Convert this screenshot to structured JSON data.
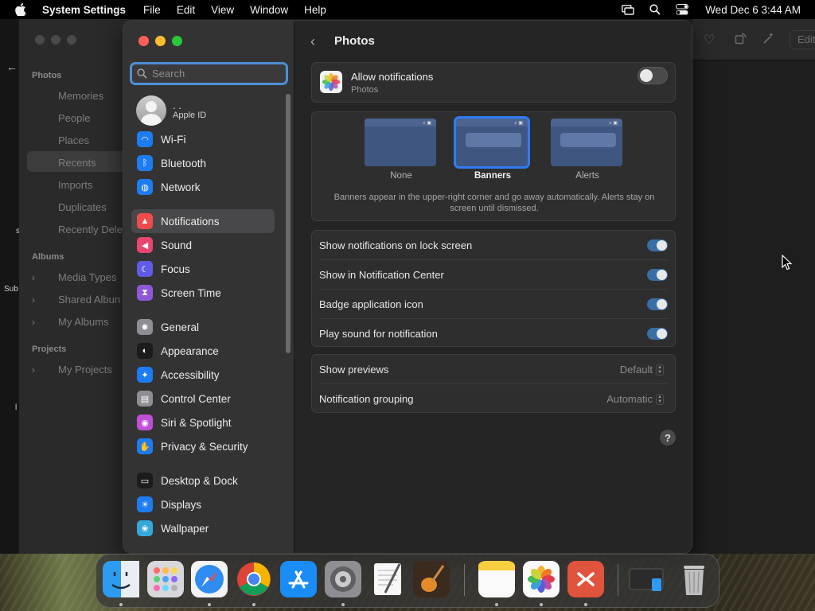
{
  "menubar": {
    "app_name": "System Settings",
    "menus": [
      "File",
      "Edit",
      "View",
      "Window",
      "Help"
    ],
    "clock": "Wed Dec 6  3:44 AM"
  },
  "photos_app": {
    "sections": {
      "photos": "Photos",
      "albums": "Albums",
      "projects": "Projects"
    },
    "items": {
      "memories": "Memories",
      "people": "People",
      "places": "Places",
      "recents": "Recents",
      "imports": "Imports",
      "duplicates": "Duplicates",
      "recently_deleted": "Recently Dele",
      "media_types": "Media Types",
      "shared_albums": "Shared Albun",
      "my_albums": "My Albums",
      "my_projects": "My Projects"
    },
    "edit_label": "Edit",
    "left_fragments": [
      "s",
      "Sub",
      "l"
    ]
  },
  "settings": {
    "search_placeholder": "Search",
    "apple_id": {
      "name": ". .",
      "label": "Apple ID"
    },
    "sidebar": [
      {
        "label": "Wi-Fi",
        "icon": "wifi-icon",
        "color": "#1e7cf2"
      },
      {
        "label": "Bluetooth",
        "icon": "bluetooth-icon",
        "color": "#1e7cf2"
      },
      {
        "label": "Network",
        "icon": "network-icon",
        "color": "#1e7cf2"
      },
      {
        "label": "Notifications",
        "icon": "bell-icon",
        "color": "#ef4b4b",
        "selected": true
      },
      {
        "label": "Sound",
        "icon": "speaker-icon",
        "color": "#e9456e"
      },
      {
        "label": "Focus",
        "icon": "moon-icon",
        "color": "#5e5ce6"
      },
      {
        "label": "Screen Time",
        "icon": "hourglass-icon",
        "color": "#8e59d8"
      },
      {
        "label": "General",
        "icon": "gear-icon",
        "color": "#8e8e93"
      },
      {
        "label": "Appearance",
        "icon": "appearance-icon",
        "color": "#1c1c1e"
      },
      {
        "label": "Accessibility",
        "icon": "accessibility-icon",
        "color": "#1e7cf2"
      },
      {
        "label": "Control Center",
        "icon": "control-center-icon",
        "color": "#8e8e93"
      },
      {
        "label": "Siri & Spotlight",
        "icon": "siri-icon",
        "color": "#c04fd6"
      },
      {
        "label": "Privacy & Security",
        "icon": "hand-icon",
        "color": "#1e7cf2"
      },
      {
        "label": "Desktop & Dock",
        "icon": "desktop-icon",
        "color": "#1c1c1e"
      },
      {
        "label": "Displays",
        "icon": "sun-icon",
        "color": "#1e7cf2"
      },
      {
        "label": "Wallpaper",
        "icon": "wallpaper-icon",
        "color": "#36a7d9"
      }
    ],
    "page": {
      "title": "Photos",
      "allow": {
        "title": "Allow notifications",
        "subtitle": "Photos",
        "enabled": false
      },
      "styles": [
        {
          "label": "None",
          "selected": false
        },
        {
          "label": "Banners",
          "selected": true
        },
        {
          "label": "Alerts",
          "selected": false
        }
      ],
      "style_description": "Banners appear in the upper-right corner and go away automatically. Alerts stay on screen until dismissed.",
      "toggles": [
        {
          "label": "Show notifications on lock screen",
          "on": true
        },
        {
          "label": "Show in Notification Center",
          "on": true
        },
        {
          "label": "Badge application icon",
          "on": true
        },
        {
          "label": "Play sound for notification",
          "on": true
        }
      ],
      "previews": {
        "label": "Show previews",
        "value": "Default"
      },
      "grouping": {
        "label": "Notification grouping",
        "value": "Automatic"
      },
      "help": "?"
    }
  },
  "dock": [
    "finder-icon",
    "launchpad-icon",
    "safari-icon",
    "chrome-icon",
    "app-store-icon",
    "system-settings-icon",
    "textedit-icon",
    "garageband-icon",
    "notes-icon",
    "photos-icon",
    "remote-desktop-icon",
    "downloads-stack-icon",
    "trash-icon"
  ]
}
